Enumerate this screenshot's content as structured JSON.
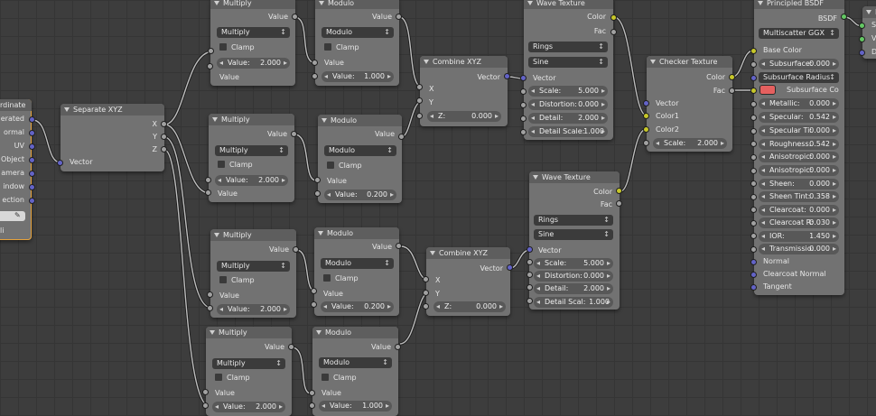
{
  "texcoord": {
    "title": "Texture Coordinate",
    "title_visible": "rdinate",
    "outputs": [
      "erated",
      "ormal",
      "UV",
      "Object",
      "amera",
      "indow",
      "ection"
    ],
    "object_field": "",
    "dupli": "li"
  },
  "separate": {
    "title": "Separate XYZ",
    "outputs": [
      "X",
      "Y",
      "Z"
    ],
    "input": "Vector"
  },
  "multiply_nodes": [
    {
      "title": "Multiply",
      "output": "Value",
      "operation": "Multiply",
      "clamp": "Clamp",
      "value_label": "Value:",
      "value": "2.000",
      "input": "Value"
    },
    {
      "title": "Multiply",
      "output": "Value",
      "operation": "Multiply",
      "clamp": "Clamp",
      "value_label": "Value:",
      "value": "2.000",
      "input": "Value"
    },
    {
      "title": "Multiply",
      "output": "Value",
      "operation": "Multiply",
      "clamp": "Clamp",
      "value_label": "Value:",
      "value": "2.000",
      "input": "Value"
    },
    {
      "title": "Multiply",
      "output": "Value",
      "operation": "Multiply",
      "clamp": "Clamp",
      "value_label": "Value:",
      "value": "2.000",
      "input": "Value"
    }
  ],
  "modulo_nodes": [
    {
      "title": "Modulo",
      "output": "Value",
      "operation": "Modulo",
      "clamp": "Clamp",
      "input": "Value",
      "value_label": "Value:",
      "value": "1.000"
    },
    {
      "title": "Modulo",
      "output": "Value",
      "operation": "Modulo",
      "clamp": "Clamp",
      "input": "Value",
      "value_label": "Value:",
      "value": "0.200"
    },
    {
      "title": "Modulo",
      "output": "Value",
      "operation": "Modulo",
      "clamp": "Clamp",
      "input": "Value",
      "value_label": "Value:",
      "value": "0.200"
    },
    {
      "title": "Modulo",
      "output": "Value",
      "operation": "Modulo",
      "clamp": "Clamp",
      "input": "Value",
      "value_label": "Value:",
      "value": "1.000"
    }
  ],
  "combine_nodes": [
    {
      "title": "Combine XYZ",
      "output": "Vector",
      "x": "X",
      "y": "Y",
      "z_label": "Z:",
      "z_value": "0.000"
    },
    {
      "title": "Combine XYZ",
      "output": "Vector",
      "x": "X",
      "y": "Y",
      "z_label": "Z:",
      "z_value": "0.000"
    }
  ],
  "wave_nodes": [
    {
      "title": "Wave Texture",
      "out_color": "Color",
      "out_fac": "Fac",
      "type": "Rings",
      "profile": "Sine",
      "input": "Vector",
      "scale_label": "Scale:",
      "scale": "5.000",
      "distortion_label": "Distortion:",
      "distortion": "0.000",
      "detail_label": "Detail:",
      "detail": "2.000",
      "detail_scale_label": "Detail Scale:",
      "detail_scale": "1.000"
    },
    {
      "title": "Wave Texture",
      "out_color": "Color",
      "out_fac": "Fac",
      "type": "Rings",
      "profile": "Sine",
      "input": "Vector",
      "scale_label": "Scale:",
      "scale": "5.000",
      "distortion_label": "Distortion:",
      "distortion": "0.000",
      "detail_label": "Detail:",
      "detail": "2.000",
      "detail_scale_label": "Detail Scal:",
      "detail_scale": "1.000"
    }
  ],
  "checker": {
    "title": "Checker Texture",
    "out_color": "Color",
    "out_fac": "Fac",
    "inputs": [
      "Vector",
      "Color1",
      "Color2"
    ],
    "scale_label": "Scale:",
    "scale": "2.000"
  },
  "bsdf": {
    "title": "Principled BSDF",
    "output": "BSDF",
    "distribution": "Multiscatter GGX",
    "base_color": "Base Color",
    "subsurface_label": "Subsurface:",
    "subsurface": "0.000",
    "subsurface_radius": "Subsurface Radius",
    "subsurface_color": "Subsurface Co",
    "params": [
      {
        "label": "Metallic:",
        "value": "0.000"
      },
      {
        "label": "Specular:",
        "value": "0.542"
      },
      {
        "label": "Specular Ti:",
        "value": "0.000"
      },
      {
        "label": "Roughness:",
        "value": "0.542"
      },
      {
        "label": "Anisotropic:",
        "value": "0.000"
      },
      {
        "label": "Anisotropic:",
        "value": "0.000"
      },
      {
        "label": "Sheen:",
        "value": "0.000"
      },
      {
        "label": "Sheen Tint:",
        "value": "0.358"
      },
      {
        "label": "Clearcoat:",
        "value": "0.000"
      },
      {
        "label": "Clearcoat R:",
        "value": "0.030"
      },
      {
        "label": "IOR:",
        "value": "1.450"
      },
      {
        "label": "Transmissio:",
        "value": "0.000"
      }
    ],
    "inputs_tail": [
      "Normal",
      "Clearcoat Normal",
      "Tangent"
    ]
  },
  "output_node": {
    "title": "M",
    "inputs": [
      "S",
      "V",
      "D"
    ]
  },
  "colors": {
    "vector_socket": "#6363c7",
    "color_socket": "#c7c729",
    "value_socket": "#a1a1a1",
    "shader_socket": "#63c763",
    "active_outline": "#e6a23c",
    "subsurface_color": "#e5605f"
  }
}
